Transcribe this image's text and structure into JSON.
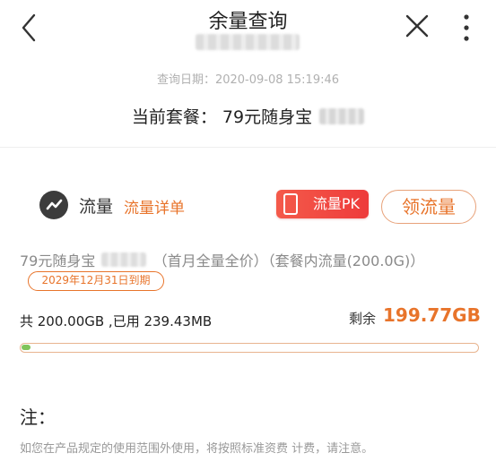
{
  "header": {
    "title": "余量查询",
    "query_date": "查询日期：2020-09-08 15:19:46",
    "plan_label": "当前套餐：",
    "plan_name": "79元随身宝"
  },
  "traffic": {
    "label": "流量",
    "detail_link": "流量详单",
    "pk_button": "流量PK",
    "claim_button": "领流量"
  },
  "package": {
    "name_prefix": "79元随身宝",
    "name_suffix": "（首月全量全价）（套餐内流量(200.0G)）",
    "expiry": "2029年12月31日到期",
    "usage": "共 200.00GB ,已用 239.43MB",
    "remaining_label": "剩余",
    "remaining_value": "199.77GB",
    "used_fraction": 0.0012
  },
  "note": {
    "title": "注：",
    "text": "如您在产品规定的使用范围外使用，将按照标准资费 计费，请注意。"
  },
  "colors": {
    "accent": "#e8742b",
    "pk_red": "#ee3b3b",
    "progress_green": "#7fc45a"
  },
  "icons": {
    "back": "back-chevron-icon",
    "close": "close-icon",
    "more": "more-vertical-icon",
    "traffic": "traffic-check-icon",
    "pk": "phone-icon"
  }
}
